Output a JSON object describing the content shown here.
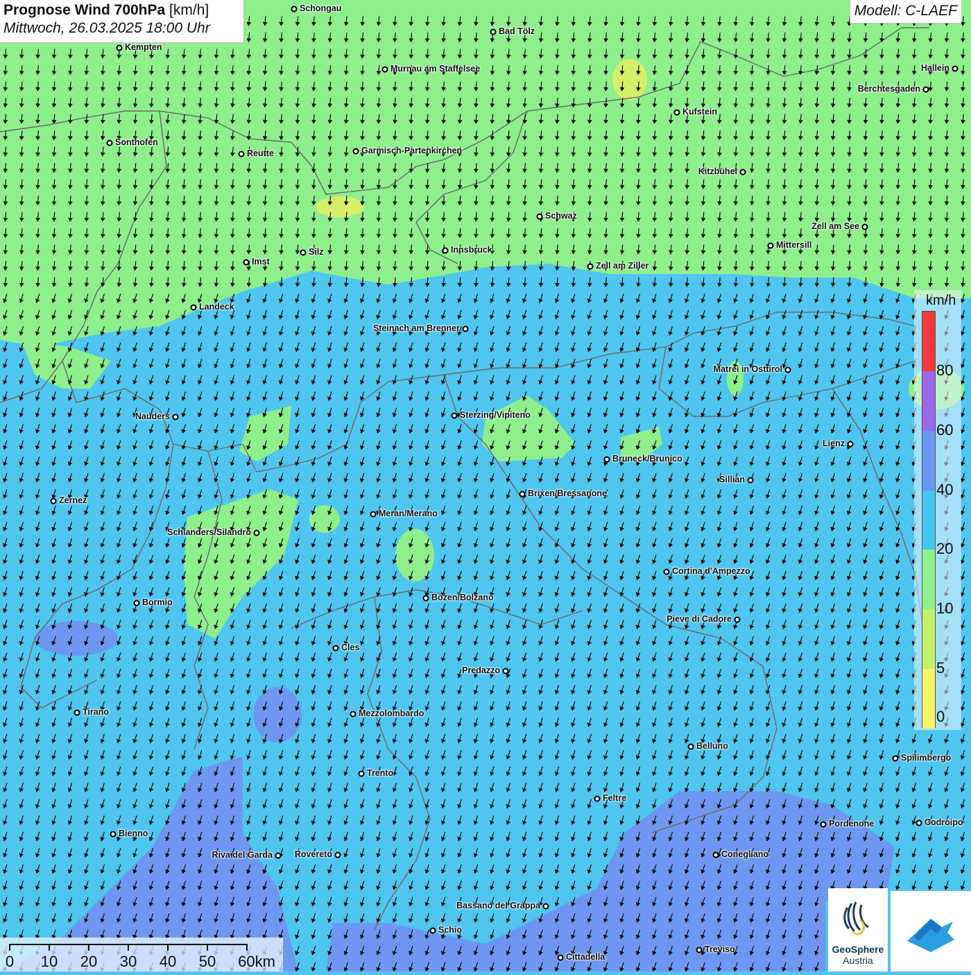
{
  "header": {
    "title_bold": "Prognose Wind 700hPa",
    "title_unit": "[km/h]",
    "datetime": "Mittwoch, 26.03.2025 18:00 Uhr"
  },
  "model_label": "Modell: C-LAEF",
  "legend": {
    "unit": "km/h",
    "bins": [
      {
        "from": 0,
        "to": 5,
        "color": "#f5f56a"
      },
      {
        "from": 5,
        "to": 10,
        "color": "#c3f06a"
      },
      {
        "from": 10,
        "to": 20,
        "color": "#8ff08a"
      },
      {
        "from": 20,
        "to": 40,
        "color": "#45c6f2"
      },
      {
        "from": 40,
        "to": 60,
        "color": "#6a96f2"
      },
      {
        "from": 60,
        "to": 80,
        "color": "#9a6ae8"
      },
      {
        "from": 80,
        "to": 100,
        "color": "#f23a3a"
      }
    ],
    "labels": [
      "0",
      "5",
      "10",
      "20",
      "40",
      "60",
      "80"
    ]
  },
  "scalebar": {
    "labels": [
      "0",
      "10",
      "20",
      "30",
      "40",
      "50",
      "60km"
    ]
  },
  "cities": [
    {
      "name": "Schongau"
    },
    {
      "name": "Bad Tölz"
    },
    {
      "name": "Kempten"
    },
    {
      "name": "Murnau am Staffelsee"
    },
    {
      "name": "Hallein"
    },
    {
      "name": "Berchtesgaden"
    },
    {
      "name": "Kufstein"
    },
    {
      "name": "Sonthofen"
    },
    {
      "name": "Reutte"
    },
    {
      "name": "Garmisch-Partenkirchen"
    },
    {
      "name": "Kitzbühel"
    },
    {
      "name": "Schwaz"
    },
    {
      "name": "Zell am See"
    },
    {
      "name": "Mittersill"
    },
    {
      "name": "Innsbruck"
    },
    {
      "name": "Silz"
    },
    {
      "name": "Imst"
    },
    {
      "name": "Zell am Ziller"
    },
    {
      "name": "Landeck"
    },
    {
      "name": "Steinach am Brenner"
    },
    {
      "name": "Matrei in Osttirol"
    },
    {
      "name": "Nauders"
    },
    {
      "name": "Sterzing/Vipiteno"
    },
    {
      "name": "Lienz"
    },
    {
      "name": "Bruneck/Brunico"
    },
    {
      "name": "Sillian"
    },
    {
      "name": "Zernez"
    },
    {
      "name": "Brixen/Bressanone"
    },
    {
      "name": "Meran/Merano"
    },
    {
      "name": "Schlanders/Silandro"
    },
    {
      "name": "Cortina d'Ampezzo"
    },
    {
      "name": "Bozen/Bolzano"
    },
    {
      "name": "Bormio"
    },
    {
      "name": "Pieve di Cadore"
    },
    {
      "name": "Cles"
    },
    {
      "name": "Predazzo"
    },
    {
      "name": "Tirano"
    },
    {
      "name": "Mezzolombardo"
    },
    {
      "name": "Belluno"
    },
    {
      "name": "Spilimbergo"
    },
    {
      "name": "Trento"
    },
    {
      "name": "Feltre"
    },
    {
      "name": "Pordenone"
    },
    {
      "name": "Codroipo"
    },
    {
      "name": "Bienno"
    },
    {
      "name": "Riva del Garda"
    },
    {
      "name": "Rovereto"
    },
    {
      "name": "Conegliano"
    },
    {
      "name": "Bassano del Grappa"
    },
    {
      "name": "Schio"
    },
    {
      "name": "Treviso"
    },
    {
      "name": "Cittadella"
    }
  ],
  "logo": {
    "brand_line1": "GeoSphere",
    "brand_line2": "Austria"
  },
  "colors": {
    "low_wind": "#8ff08a",
    "mid_wind": "#4fc6f0",
    "high_wind": "#6a96f2",
    "arrow": "#000000"
  }
}
